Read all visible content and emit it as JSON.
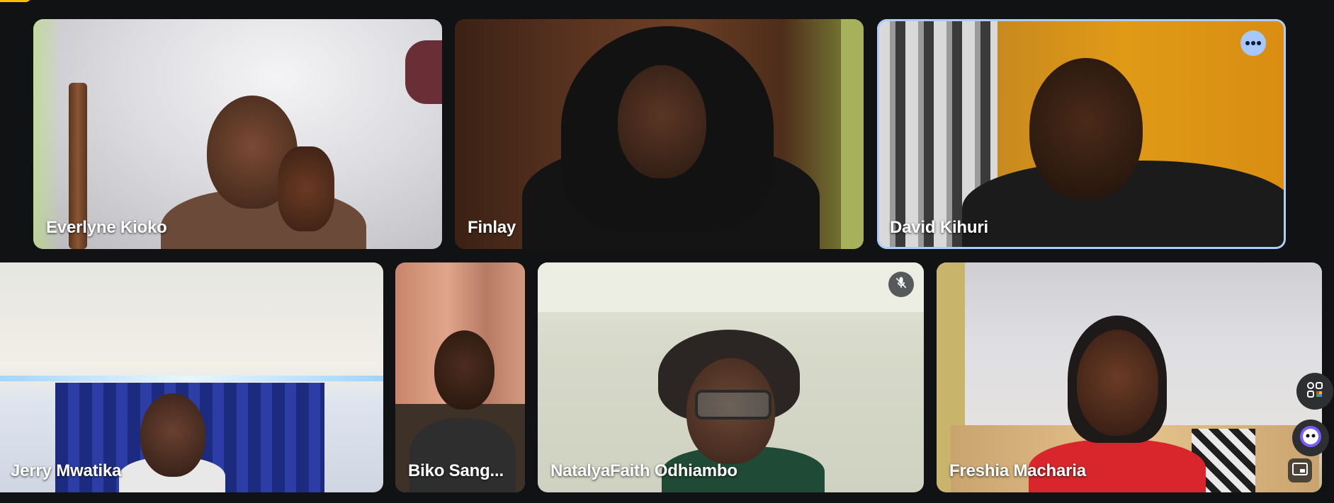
{
  "participants": [
    {
      "name": "Everlyne Kioko"
    },
    {
      "name": "Finlay"
    },
    {
      "name": "David Kihuri"
    },
    {
      "name": "Jerry Mwatika"
    },
    {
      "name": "Biko Sang..."
    },
    {
      "name": "NatalyaFaith Odhiambo"
    },
    {
      "name": "Freshia Macharia"
    }
  ],
  "icons": {
    "more_options": "more-horiz-icon",
    "muted": "mic-off-icon",
    "activities": "apps-icon",
    "companion": "companion-icon",
    "pip": "picture-in-picture-icon"
  },
  "colors": {
    "background": "#111214",
    "active_speaker_border": "#aecbfa",
    "more_button": "#a8c7fa",
    "top_indicator": "#fbbc04"
  }
}
